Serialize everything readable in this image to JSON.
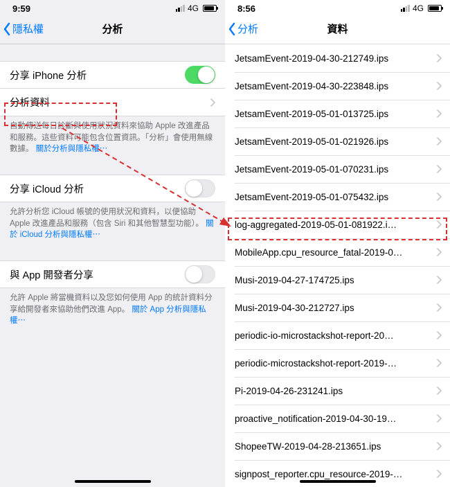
{
  "left": {
    "status_time": "9:59",
    "signal_text": "4G",
    "back_label": "隱私權",
    "title": "分析",
    "share_iphone_label": "分享 iPhone 分析",
    "analytics_data_label": "分析資料",
    "footer1_text": "自動傳送每日診斷與使用狀況資料來協助 Apple 改進產品和服務。這些資料可能包含位置資訊。「分析」會使用無線數據。",
    "footer1_link": "關於分析與隱私權⋯",
    "share_icloud_label": "分享 iCloud 分析",
    "footer2_text": "允許分析您 iCloud 帳號的使用狀況和資料，以便協助 Apple 改進產品和服務（包含 Siri 和其他智慧型功能）。",
    "footer2_link": "關於 iCloud 分析與隱私權⋯",
    "share_dev_label": "與 App 開發者分享",
    "footer3_text": "允許 Apple 將當機資料以及您如何使用 App 的統計資料分享給開發者來協助他們改進 App。",
    "footer3_link": "關於 App 分析與隱私權⋯"
  },
  "right": {
    "status_time": "8:56",
    "signal_text": "4G",
    "back_label": "分析",
    "title": "資料",
    "items": [
      "JetsamEvent-2019-04-30-212749.ips",
      "JetsamEvent-2019-04-30-223848.ips",
      "JetsamEvent-2019-05-01-013725.ips",
      "JetsamEvent-2019-05-01-021926.ips",
      "JetsamEvent-2019-05-01-070231.ips",
      "JetsamEvent-2019-05-01-075432.ips",
      "log-aggregated-2019-05-01-081922.i…",
      "MobileApp.cpu_resource_fatal-2019-0…",
      "Musi-2019-04-27-174725.ips",
      "Musi-2019-04-30-212727.ips",
      "periodic-io-microstackshot-report-20…",
      "periodic-microstackshot-report-2019-…",
      "Pi-2019-04-26-231241.ips",
      "proactive_notification-2019-04-30-19…",
      "ShopeeTW-2019-04-28-213651.ips",
      "signpost_reporter.cpu_resource-2019-…"
    ]
  }
}
